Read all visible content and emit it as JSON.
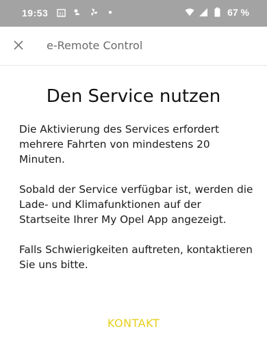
{
  "status_bar": {
    "time": "19:53",
    "battery_percent": "67 %",
    "icons_left": [
      "calendar-icon",
      "weather-icon",
      "fan-icon",
      "dot-icon"
    ],
    "icons_right": [
      "wifi-icon",
      "signal-icon",
      "battery-icon"
    ]
  },
  "app_bar": {
    "close_icon": "close-icon",
    "title": "e-Remote Control"
  },
  "main": {
    "title": "Den Service nutzen",
    "paragraphs": [
      "Die Aktivierung des Services erfordert mehrere Fahrten von mindestens 20 Minuten.",
      "Sobald der Service verfügbar ist, werden die Lade- und Klimafunktionen auf der Startseite Ihrer My Opel App angezeigt.",
      "Falls Schwierigkeiten auftreten, kontaktieren Sie uns bitte."
    ],
    "contact_label": "KONTAKT"
  },
  "colors": {
    "status_bar_bg": "#a3a3a3",
    "accent": "#e6cf1c",
    "title_text": "#6b6b6b"
  }
}
